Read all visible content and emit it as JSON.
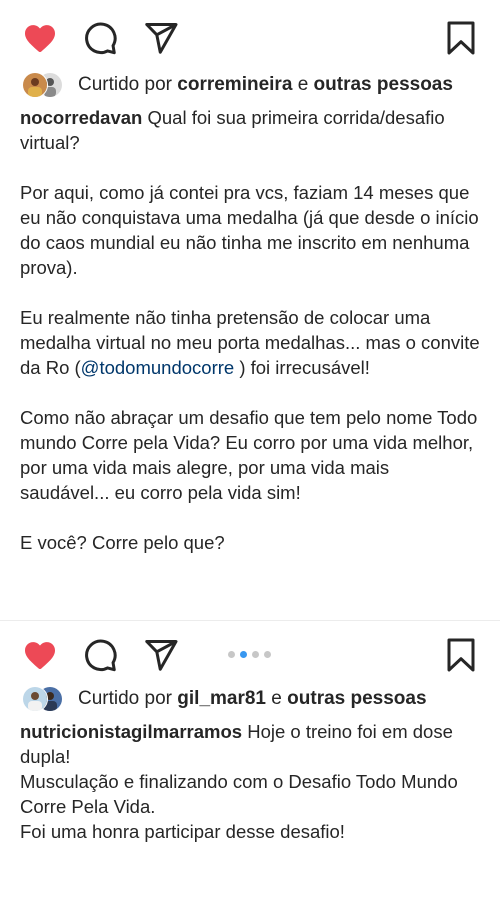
{
  "post1": {
    "liked_by_prefix": "Curtido por",
    "liked_by_user": "corremineira",
    "liked_by_connector": "e",
    "liked_by_others": "outras pessoas",
    "caption_username": "nocorredavan",
    "caption_first": "Qual foi sua primeira corrida/desafio virtual?",
    "paragraph2": "Por aqui, como já contei pra vcs, faziam 14 meses que eu não conquistava uma medalha (já que desde o início do caos mundial eu não tinha me inscrito em nenhuma prova).",
    "paragraph3_before": "Eu realmente não tinha pretensão de  colocar uma medalha virtual no meu porta medalhas... mas o convite da Ro (",
    "paragraph3_mention": "@todomundocorre",
    "paragraph3_after": " ) foi irrecusável!",
    "paragraph4": "Como não abraçar um desafio que tem pelo nome Todo mundo Corre pela Vida? Eu corro por uma vida melhor, por uma vida mais alegre, por uma vida mais saudável... eu corro pela vida sim!",
    "paragraph5": "E você? Corre pelo que?"
  },
  "post2": {
    "carousel_total": 4,
    "carousel_active": 2,
    "liked_by_prefix": "Curtido por",
    "liked_by_user": "gil_mar81",
    "liked_by_connector": "e",
    "liked_by_others": "outras pessoas",
    "caption_username": "nutricionistagilmarramos",
    "caption_first": "Hoje o treino foi em dose dupla!",
    "line2": "Musculação  e finalizando  com o Desafio  Todo Mundo Corre Pela Vida.",
    "line3": "Foi uma honra participar  desse desafio!"
  },
  "colors": {
    "like_red": "#ed4956",
    "carousel_blue": "#3897f0",
    "mention_blue": "#00376b",
    "text": "#262626"
  },
  "icons": [
    "heart-icon",
    "comment-icon",
    "share-icon",
    "bookmark-icon"
  ]
}
